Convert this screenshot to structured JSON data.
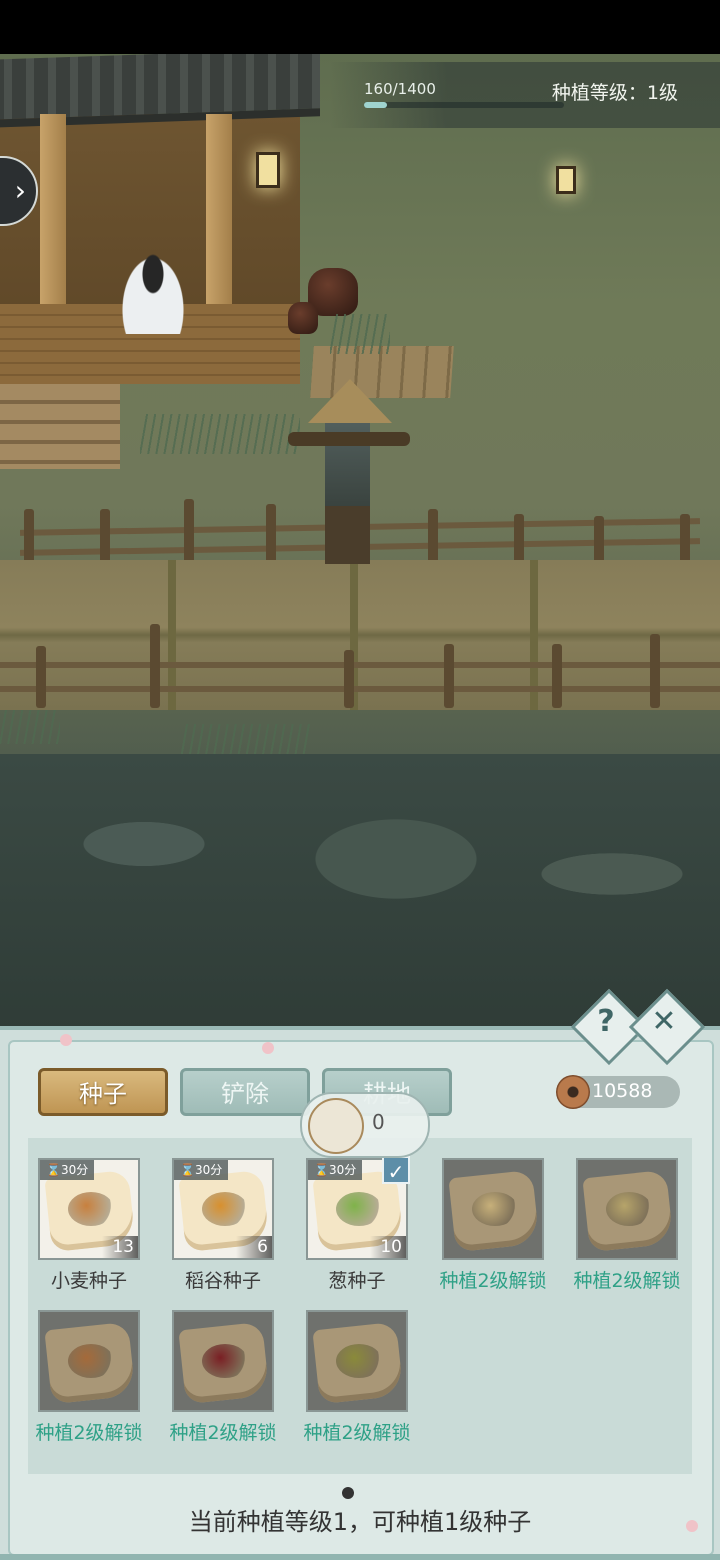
{
  "hud": {
    "xp_text": "160/1400",
    "xp_current": 160,
    "xp_max": 1400,
    "planting_level_text": "种植等级：1级",
    "side_arrow": "chevron-right-icon"
  },
  "panel": {
    "tabs": [
      {
        "label": "种子",
        "active": true
      },
      {
        "label": "铲除",
        "active": false
      },
      {
        "label": "耕地",
        "active": false
      }
    ],
    "currency": {
      "icon": "copper-coin-icon",
      "amount": "10588"
    },
    "help_label": "?",
    "close_label": "✕",
    "tooltip": {
      "icon": "scallion-seed-icon",
      "count": "0"
    },
    "seeds": [
      {
        "name": "小麦种子",
        "timer": "30分",
        "count": "13",
        "locked": false,
        "selected": false,
        "color": "#c8803e"
      },
      {
        "name": "稻谷种子",
        "timer": "30分",
        "count": "6",
        "locked": false,
        "selected": false,
        "color": "#d8902e"
      },
      {
        "name": "葱种子",
        "timer": "30分",
        "count": "10",
        "locked": false,
        "selected": true,
        "color": "#7fb34a"
      },
      {
        "name": "种植2级解锁",
        "locked": true,
        "color": "#c7b07a"
      },
      {
        "name": "种植2级解锁",
        "locked": true,
        "color": "#b6a46a"
      },
      {
        "name": "种植2级解锁",
        "locked": true,
        "color": "#a56a3a"
      },
      {
        "name": "种植2级解锁",
        "locked": true,
        "color": "#7a1f24"
      },
      {
        "name": "种植2级解锁",
        "locked": true,
        "color": "#8a8a3a"
      }
    ],
    "footer": "当前种植等级1，可种植1级种子"
  },
  "colors": {
    "accent_gold": "#c89e5c",
    "locked_green": "#2fa187",
    "panel_bg": "#dde9e6"
  }
}
